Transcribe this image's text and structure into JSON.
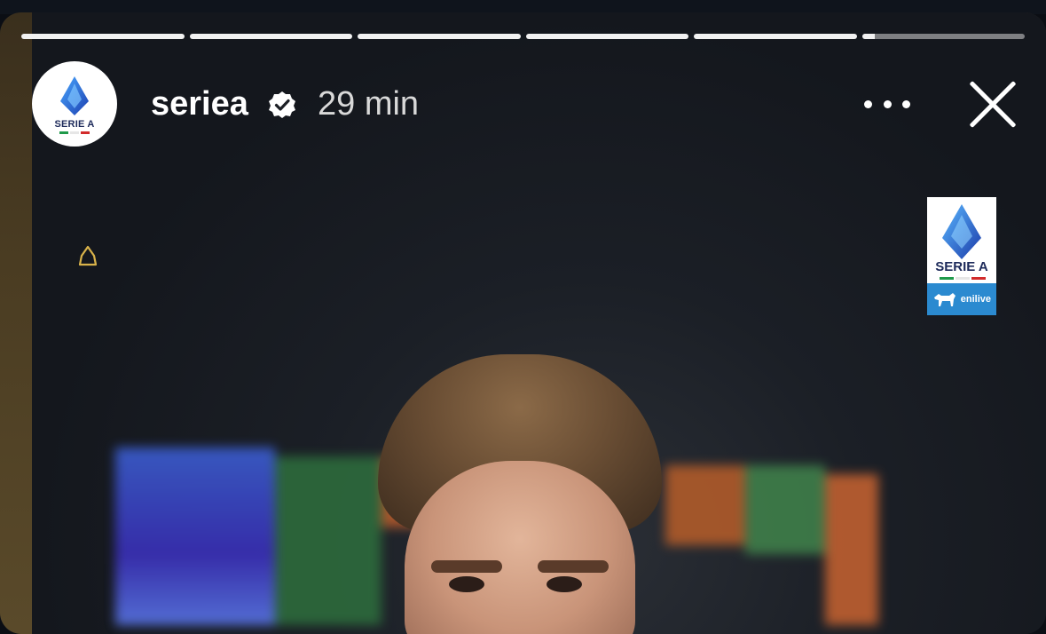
{
  "story": {
    "progress": [
      1,
      1,
      1,
      1,
      1,
      0.08
    ],
    "username": "seriea",
    "time_ago": "29 min",
    "avatar_label": "SERIE A",
    "badge": {
      "label": "SERIE A",
      "sponsor": "enilive"
    },
    "icons": {
      "verified": "verified-badge-icon",
      "more": "more-options-icon",
      "close": "close-icon"
    },
    "colors": {
      "bar_track": "#8a8a8a",
      "bar_fill": "#f2f2f2",
      "brand_blue": "#2b8ad0"
    }
  }
}
